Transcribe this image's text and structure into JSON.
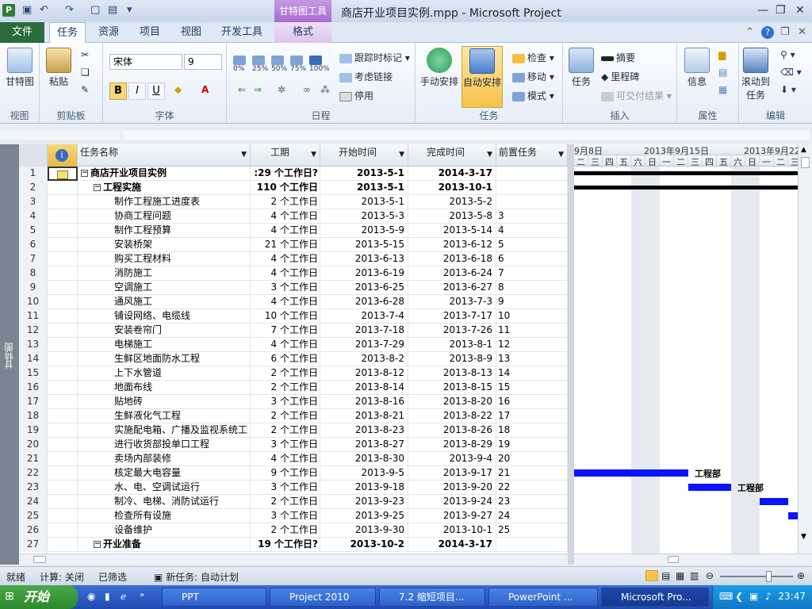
{
  "window": {
    "title": "商店开业项目实例.mpp  -  Microsoft Project",
    "context_tab_group": "甘特图工具"
  },
  "tabs": {
    "file": "文件",
    "items": [
      "任务",
      "资源",
      "项目",
      "视图",
      "开发工具",
      "格式"
    ]
  },
  "ribbon": {
    "view_group": {
      "label": "视图",
      "gantt": "甘特图"
    },
    "clipboard_group": {
      "label": "剪贴板",
      "paste": "粘贴"
    },
    "font_group": {
      "label": "字体",
      "font": "宋体",
      "size": "9",
      "bold": "B",
      "italic": "I",
      "underline": "U"
    },
    "schedule_group": {
      "label": "日程",
      "pcts": [
        "0%",
        "25%",
        "50%",
        "75%",
        "100%"
      ],
      "mark_on_track": "跟踪时标记",
      "respect_links": "考虑链接",
      "inactivate": "停用"
    },
    "tasks_group": {
      "label": "任务",
      "manual": "手动安排",
      "auto": "自动安排",
      "inspect": "检查",
      "move": "移动",
      "mode": "模式"
    },
    "insert_group": {
      "label": "插入",
      "task": "任务",
      "summary": "摘要",
      "milestone": "里程碑",
      "deliverable": "可交付结果"
    },
    "properties_group": {
      "label": "属性",
      "info": "信息"
    },
    "editing_group": {
      "label": "编辑",
      "scroll_to_task": "滚动到任务"
    }
  },
  "view_bar_label": "甘特图",
  "table": {
    "headers": {
      "name": "任务名称",
      "duration": "工期",
      "start": "开始时间",
      "finish": "完成时间",
      "pred": "前置任务"
    },
    "rows": [
      {
        "id": "1",
        "name": "商店开业项目实例",
        "duration": ":29 个工作日?",
        "start": "2013-5-1",
        "finish": "2014-3-17",
        "pred": "",
        "level": 0,
        "summary": true
      },
      {
        "id": "2",
        "name": "工程实施",
        "duration": "110 个工作日",
        "start": "2013-5-1",
        "finish": "2013-10-1",
        "pred": "",
        "level": 1,
        "summary": true
      },
      {
        "id": "3",
        "name": "制作工程施工进度表",
        "duration": "2 个工作日",
        "start": "2013-5-1",
        "finish": "2013-5-2",
        "pred": "",
        "level": 2
      },
      {
        "id": "4",
        "name": "协商工程问题",
        "duration": "4 个工作日",
        "start": "2013-5-3",
        "finish": "2013-5-8",
        "pred": "3",
        "level": 2
      },
      {
        "id": "5",
        "name": "制作工程预算",
        "duration": "4 个工作日",
        "start": "2013-5-9",
        "finish": "2013-5-14",
        "pred": "4",
        "level": 2
      },
      {
        "id": "6",
        "name": "安装桥架",
        "duration": "21 个工作日",
        "start": "2013-5-15",
        "finish": "2013-6-12",
        "pred": "5",
        "level": 2
      },
      {
        "id": "7",
        "name": "购买工程材料",
        "duration": "4 个工作日",
        "start": "2013-6-13",
        "finish": "2013-6-18",
        "pred": "6",
        "level": 2
      },
      {
        "id": "8",
        "name": "消防施工",
        "duration": "4 个工作日",
        "start": "2013-6-19",
        "finish": "2013-6-24",
        "pred": "7",
        "level": 2
      },
      {
        "id": "9",
        "name": "空调施工",
        "duration": "3 个工作日",
        "start": "2013-6-25",
        "finish": "2013-6-27",
        "pred": "8",
        "level": 2
      },
      {
        "id": "10",
        "name": "通风施工",
        "duration": "4 个工作日",
        "start": "2013-6-28",
        "finish": "2013-7-3",
        "pred": "9",
        "level": 2
      },
      {
        "id": "11",
        "name": "铺设网络、电缆线",
        "duration": "10 个工作日",
        "start": "2013-7-4",
        "finish": "2013-7-17",
        "pred": "10",
        "level": 2
      },
      {
        "id": "12",
        "name": "安装卷帘门",
        "duration": "7 个工作日",
        "start": "2013-7-18",
        "finish": "2013-7-26",
        "pred": "11",
        "level": 2
      },
      {
        "id": "13",
        "name": "电梯施工",
        "duration": "4 个工作日",
        "start": "2013-7-29",
        "finish": "2013-8-1",
        "pred": "12",
        "level": 2
      },
      {
        "id": "14",
        "name": "生鲜区地面防水工程",
        "duration": "6 个工作日",
        "start": "2013-8-2",
        "finish": "2013-8-9",
        "pred": "13",
        "level": 2
      },
      {
        "id": "15",
        "name": "上下水管道",
        "duration": "2 个工作日",
        "start": "2013-8-12",
        "finish": "2013-8-13",
        "pred": "14",
        "level": 2
      },
      {
        "id": "16",
        "name": "地面布线",
        "duration": "2 个工作日",
        "start": "2013-8-14",
        "finish": "2013-8-15",
        "pred": "15",
        "level": 2
      },
      {
        "id": "17",
        "name": "贴地砖",
        "duration": "3 个工作日",
        "start": "2013-8-16",
        "finish": "2013-8-20",
        "pred": "16",
        "level": 2
      },
      {
        "id": "18",
        "name": "生鲜液化气工程",
        "duration": "2 个工作日",
        "start": "2013-8-21",
        "finish": "2013-8-22",
        "pred": "17",
        "level": 2
      },
      {
        "id": "19",
        "name": "实施配电箱、广播及监视系统工",
        "duration": "2 个工作日",
        "start": "2013-8-23",
        "finish": "2013-8-26",
        "pred": "18",
        "level": 2
      },
      {
        "id": "20",
        "name": "进行收货部投单口工程",
        "duration": "3 个工作日",
        "start": "2013-8-27",
        "finish": "2013-8-29",
        "pred": "19",
        "level": 2
      },
      {
        "id": "21",
        "name": "卖场内部装修",
        "duration": "4 个工作日",
        "start": "2013-8-30",
        "finish": "2013-9-4",
        "pred": "20",
        "level": 2
      },
      {
        "id": "22",
        "name": "核定最大电容量",
        "duration": "9 个工作日",
        "start": "2013-9-5",
        "finish": "2013-9-17",
        "pred": "21",
        "level": 2
      },
      {
        "id": "23",
        "name": "水、电、空调试运行",
        "duration": "3 个工作日",
        "start": "2013-9-18",
        "finish": "2013-9-20",
        "pred": "22",
        "level": 2
      },
      {
        "id": "24",
        "name": "制冷、电梯、消防试运行",
        "duration": "2 个工作日",
        "start": "2013-9-23",
        "finish": "2013-9-24",
        "pred": "23",
        "level": 2
      },
      {
        "id": "25",
        "name": "检查所有设施",
        "duration": "3 个工作日",
        "start": "2013-9-25",
        "finish": "2013-9-27",
        "pred": "24",
        "level": 2
      },
      {
        "id": "26",
        "name": "设备维护",
        "duration": "2 个工作日",
        "start": "2013-9-30",
        "finish": "2013-10-1",
        "pred": "25",
        "level": 2
      },
      {
        "id": "27",
        "name": "开业准备",
        "duration": "19 个工作日?",
        "start": "2013-10-2",
        "finish": "2014-3-17",
        "pred": "",
        "level": 1,
        "summary": true
      }
    ]
  },
  "gantt": {
    "weeks": [
      "9月8日",
      "2013年9月15日",
      "2013年9月22"
    ],
    "days": [
      "二",
      "三",
      "四",
      "五",
      "六",
      "日",
      "一",
      "二",
      "三",
      "四",
      "五",
      "六",
      "日",
      "一",
      "二",
      "三"
    ],
    "bar_color": "#0a14ff",
    "resource_labels": [
      "工程部",
      "工程部"
    ]
  },
  "status": {
    "ready": "就绪",
    "calc": "计算: 关闭",
    "filtered": "已筛选",
    "new_tasks": "新任务: 自动计划"
  },
  "taskbar": {
    "start": "开始",
    "buttons": [
      "PPT",
      "Project 2010",
      "7.2 缩短项目...",
      "PowerPoint ...",
      "Microsoft Pro..."
    ],
    "clock": "23:47"
  }
}
